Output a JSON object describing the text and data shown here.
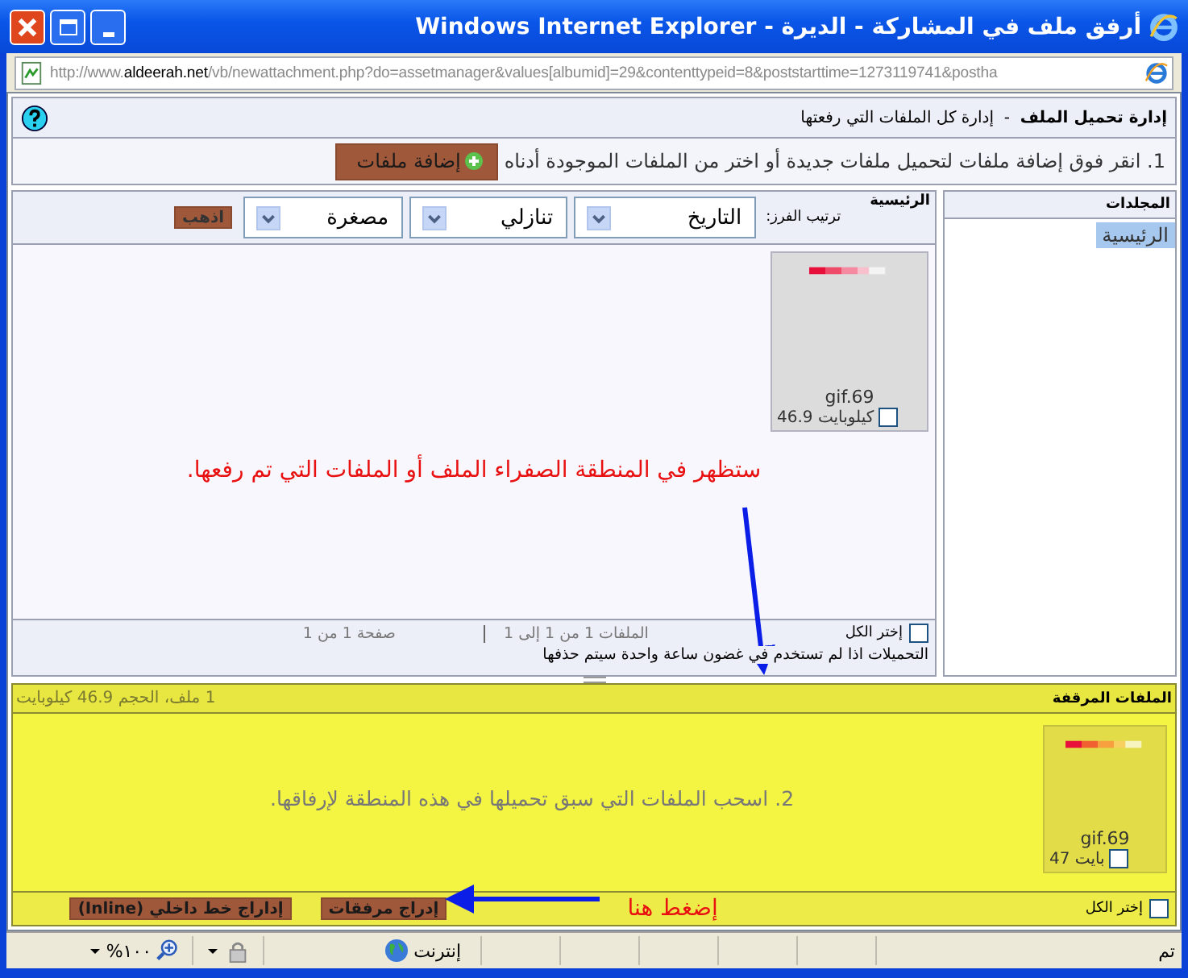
{
  "window": {
    "title": "أرفق ملف في المشاركة - الديرة - Windows Internet Explorer"
  },
  "address_bar": {
    "prefix": "http://www.",
    "host": "aldeerah.net",
    "path": "/vb/newattachment.php?do=assetmanager&values[albumid]=29&contenttypeid=8&poststarttime=1273119741&postha"
  },
  "header": {
    "title": "إدارة تحميل الملف",
    "separator": "-",
    "subtitle": "إدارة كل الملفات التي رفعتها"
  },
  "instruction": {
    "text": "1. انقر فوق إضافة ملفات لتحميل ملفات جديدة أو اختر من الملفات الموجودة أدناه",
    "button": "إضافة ملفات"
  },
  "folders": {
    "title": "المجلدات",
    "items": [
      {
        "label": "الرئيسية",
        "selected": true
      }
    ]
  },
  "main_panel": {
    "title": "الرئيسية",
    "sort_label": "ترتيب الفرز:",
    "selects": [
      "التاريخ",
      "تنازلي",
      "مصغرة"
    ],
    "go_button": "اذهب",
    "files": [
      {
        "name": "gif.69",
        "size": "46.9 كيلوبايت",
        "checked": false
      }
    ],
    "annotation": "ستظهر في المنطقة الصفراء الملف أو الملفات التي تم رفعها.",
    "select_all": {
      "label": "إختر الكل",
      "checked": false
    },
    "count": "الملفات 1 من 1 إلى 1",
    "page": "صفحة 1 من 1",
    "note": "التحميلات اذا لم تستخدم في غضون ساعة واحدة سيتم حذفها"
  },
  "attached_panel": {
    "title": "الملفات المرقفة",
    "summary": "1 ملف، الحجم 46.9 كيلوبايت",
    "files": [
      {
        "name": "gif.69",
        "size": "47 بايت",
        "checked": false
      }
    ],
    "hint": "2. اسحب الملفات التي سبق تحميلها في هذه المنطقة لإرفاقها.",
    "select_all": {
      "label": "إختر الكل",
      "checked": false
    },
    "annotation": "إضغط هنا",
    "buttons": [
      "إدراج مرفقات",
      "إداراج خط داخلي (Inline)"
    ]
  },
  "status_bar": {
    "status": "تم",
    "zone": "إنترنت",
    "zoom": "١٠٠%"
  }
}
